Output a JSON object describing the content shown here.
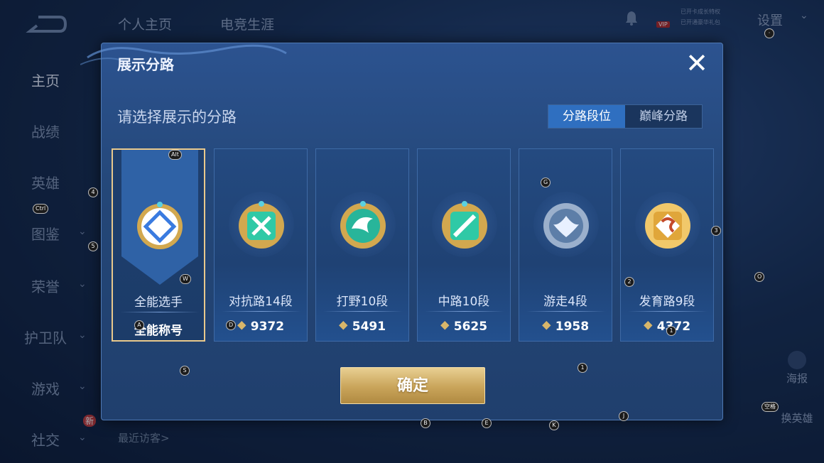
{
  "header": {
    "tabs": [
      "个人主页",
      "电竞生涯"
    ],
    "vip_label": "VIP",
    "vip_line1": "已开卡成长特权",
    "vip_line2": "已开通豪华礼包",
    "settings_label": "设置"
  },
  "sidebar": {
    "items": [
      {
        "label": "主页"
      },
      {
        "label": "战绩"
      },
      {
        "label": "英雄"
      },
      {
        "label": "图鉴"
      },
      {
        "label": "荣誉"
      },
      {
        "label": "护卫队"
      },
      {
        "label": "游戏"
      },
      {
        "label": "社交"
      }
    ],
    "new_badge": "新"
  },
  "footer": {
    "recent_visitors": "最近访客>"
  },
  "right_buttons": {
    "poster": "海报",
    "switch_hero": "换英雄"
  },
  "keyboard_hints": {
    "alt": "Alt",
    "w": "W",
    "a": "A",
    "d": "D",
    "s": "S",
    "g": "G",
    "n4": "4",
    "n5": "5",
    "n3": "3",
    "n2": "2",
    "n1": "1",
    "o": "O",
    "ctrl": "Ctrl",
    "space": "空格",
    "b": "B",
    "e": "E",
    "k": "K",
    "j": "J",
    "dot": "·"
  },
  "modal": {
    "title": "展示分路",
    "close_symbol": "✕",
    "subtitle": "请选择展示的分路",
    "segments": [
      {
        "label": "分路段位",
        "active": true
      },
      {
        "label": "巅峰分路",
        "active": false
      }
    ],
    "cards": [
      {
        "role": "全能选手",
        "score": "全能称号",
        "show_mark": false,
        "selected": true,
        "emblem": "all-round-emblem-icon",
        "color": "#3a7be0"
      },
      {
        "role": "对抗路14段",
        "score": "9372",
        "show_mark": true,
        "selected": false,
        "emblem": "clash-lane-emblem-icon",
        "color": "#2fc9a6"
      },
      {
        "role": "打野10段",
        "score": "5491",
        "show_mark": true,
        "selected": false,
        "emblem": "jungle-emblem-icon",
        "color": "#28b59a"
      },
      {
        "role": "中路10段",
        "score": "5625",
        "show_mark": true,
        "selected": false,
        "emblem": "mid-lane-emblem-icon",
        "color": "#2fc9a6"
      },
      {
        "role": "游走4段",
        "score": "1958",
        "show_mark": true,
        "selected": false,
        "emblem": "roam-emblem-icon",
        "color": "#9bb0cc"
      },
      {
        "role": "发育路9段",
        "score": "4372",
        "show_mark": true,
        "selected": false,
        "emblem": "farm-lane-emblem-icon",
        "color": "#e0a63a"
      }
    ],
    "confirm_label": "确定",
    "score_mark": "⯁"
  }
}
